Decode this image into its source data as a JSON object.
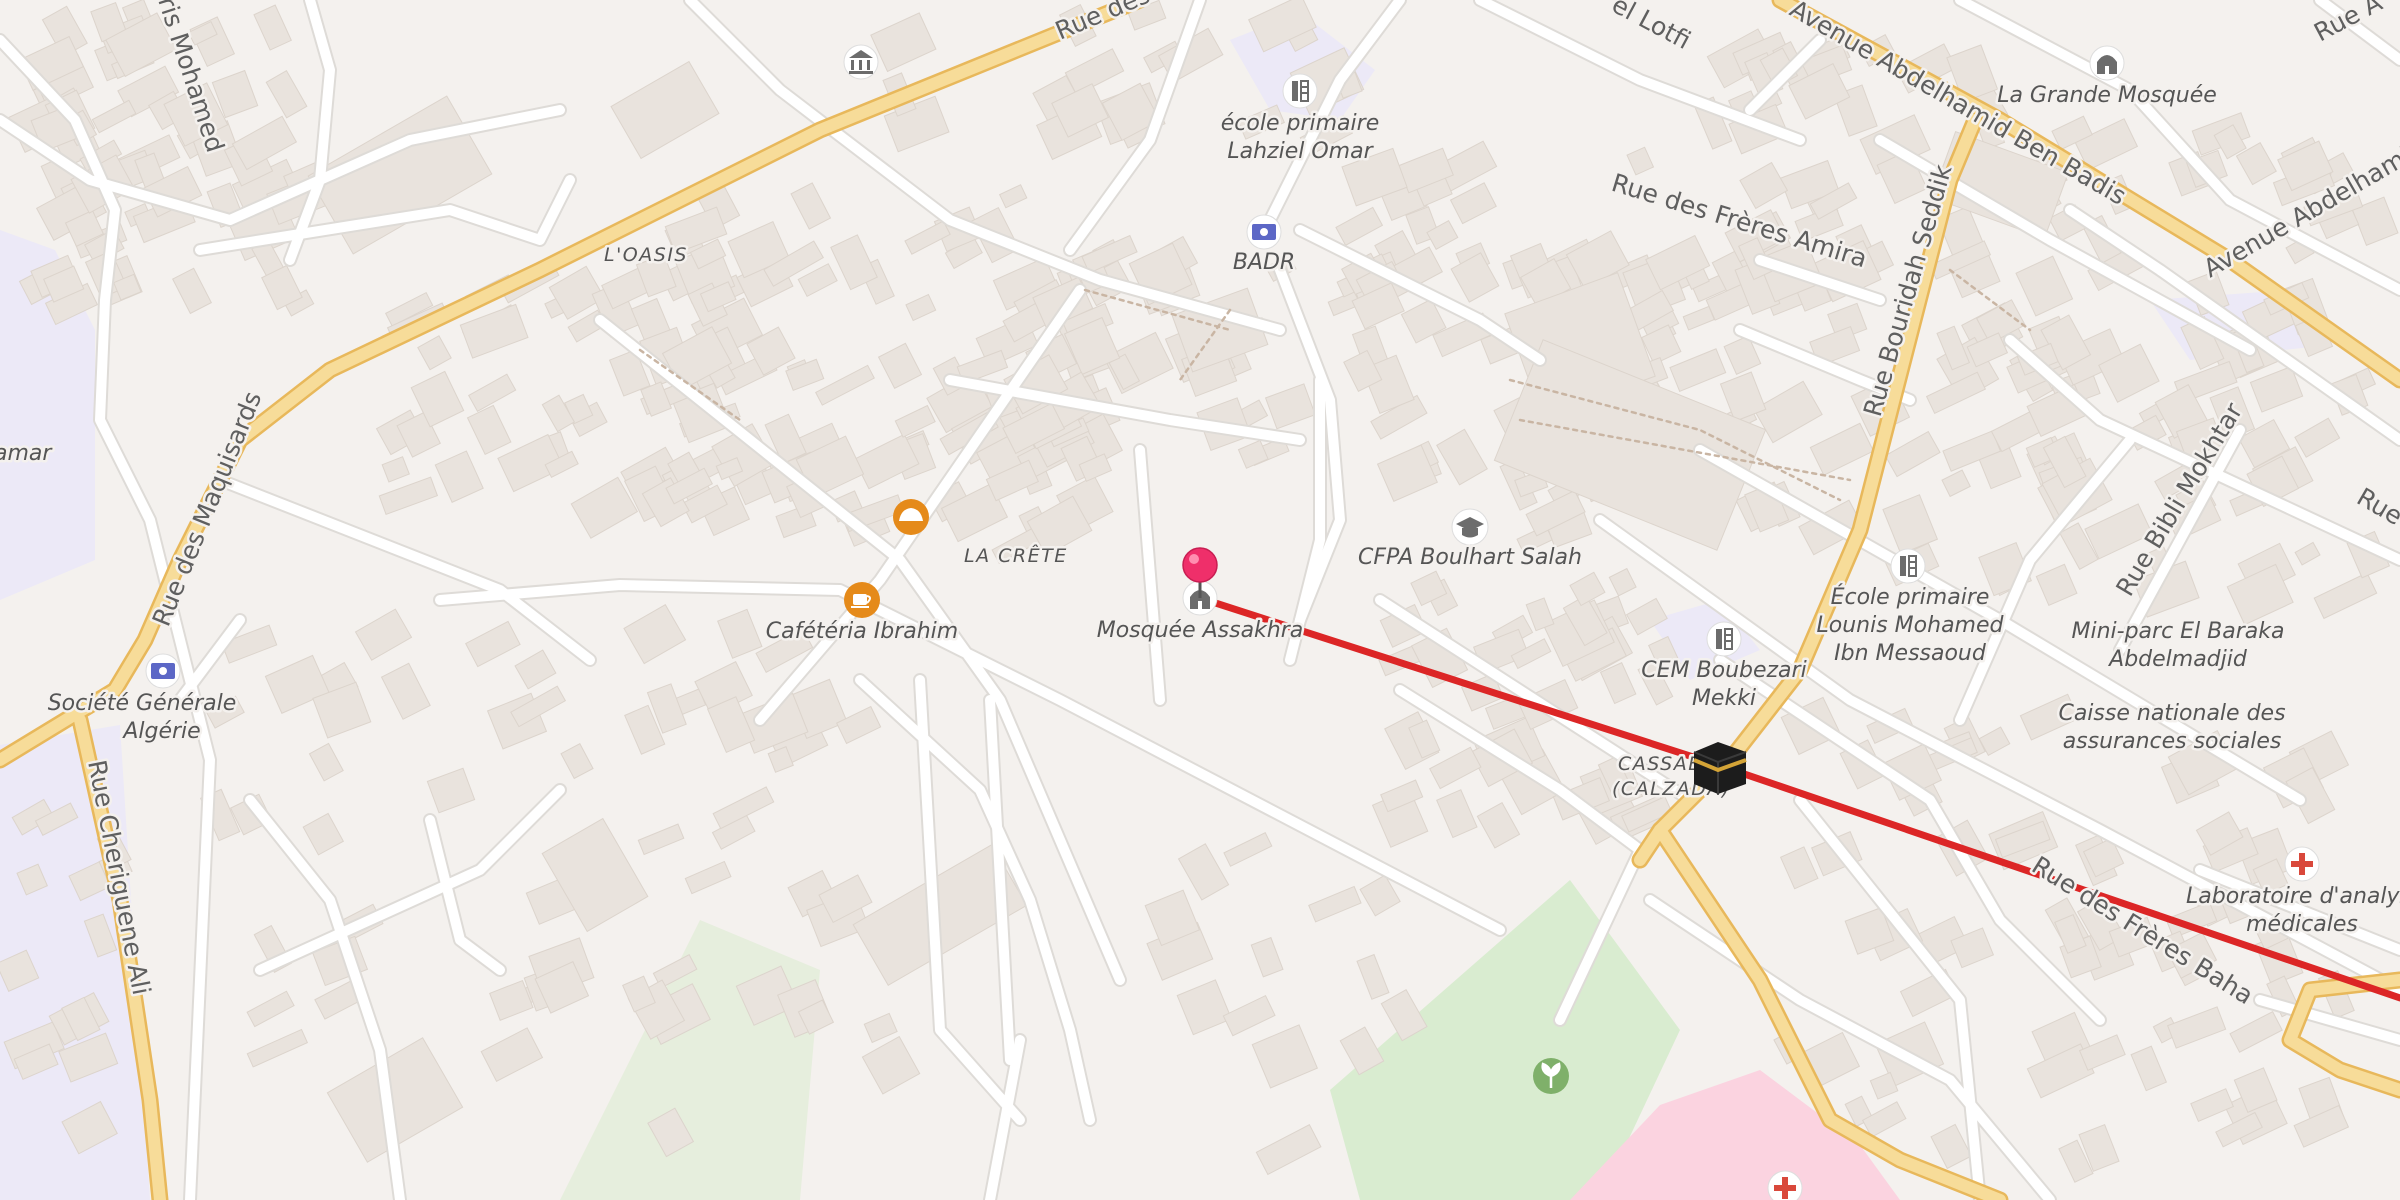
{
  "map": {
    "colors": {
      "background": "#f4f1ee",
      "major_road_fill": "#f7dc99",
      "major_road_casing": "#e8b85b",
      "minor_road": "#ffffff",
      "minor_road_casing": "#dedbd7",
      "building": "#e9e3dd",
      "park": "#d9ecd0",
      "school_area": "#ece9f7",
      "hospital_area": "#fbd3e0",
      "route_line": "#dc2626",
      "pin": "#ef2f6a"
    },
    "street_labels": [
      {
        "text": "Rue des Maquisards"
      },
      {
        "text": "Rue des"
      },
      {
        "text": "Rue Cheriguene Ali"
      },
      {
        "text": "Avenue Abdelhamid Ben Badis"
      },
      {
        "text": "Avenue Abdelhamid"
      },
      {
        "text": "Rue des Frères Amira"
      },
      {
        "text": "Rue Bouridah Seddik"
      },
      {
        "text": "Rue Bibli Mokhtar"
      },
      {
        "text": "Rue des Frères Baha"
      },
      {
        "text": "ris Mohamed"
      },
      {
        "text": "el Lotfi"
      },
      {
        "text": "Rue A"
      },
      {
        "text": "Rue"
      }
    ],
    "area_labels": [
      {
        "text": "L'OASIS"
      },
      {
        "text": "LA CRÊTE"
      },
      {
        "text": "CASSAB"
      },
      {
        "text": "(CALZADA)"
      }
    ],
    "pois": [
      {
        "name": "école primaire Lahziel Omar",
        "lines": [
          "école primaire",
          "Lahziel Omar"
        ],
        "icon": "school-icon"
      },
      {
        "name": "BADR",
        "lines": [
          "BADR"
        ],
        "icon": "bank-icon"
      },
      {
        "name": "La Grande Mosquée",
        "lines": [
          "La Grande Mosquée"
        ],
        "icon": "mosque-icon"
      },
      {
        "name": "CFPA Boulhart Salah",
        "lines": [
          "CFPA Boulhart Salah"
        ],
        "icon": "graduation-cap-icon"
      },
      {
        "name": "École primaire Lounis Mohamed Ibn Messaoud",
        "lines": [
          "École primaire",
          "Lounis Mohamed",
          "Ibn Messaoud"
        ],
        "icon": "school-icon"
      },
      {
        "name": "CEM Boubezari Mekki",
        "lines": [
          "CEM Boubezari",
          "Mekki"
        ],
        "icon": "school-icon"
      },
      {
        "name": "Mini-parc El Baraka Abdelmadjid",
        "lines": [
          "Mini-parc El Baraka",
          "Abdelmadjid"
        ],
        "icon": ""
      },
      {
        "name": "Caisse nationale des assurances sociales",
        "lines": [
          "Caisse nationale des",
          "assurances sociales"
        ],
        "icon": ""
      },
      {
        "name": "Laboratoire d'analyses médicales",
        "lines": [
          "Laboratoire d'analyse",
          "médicales"
        ],
        "icon": "medical-cross-icon"
      },
      {
        "name": "Cafétéria Ibrahim",
        "lines": [
          "Cafétéria Ibrahim"
        ],
        "icon": "coffee-icon"
      },
      {
        "name": "Mosquée Assakhra",
        "lines": [
          "Mosquée Assakhra"
        ],
        "icon": "mosque-icon"
      },
      {
        "name": "Société Générale Algérie",
        "lines": [
          "Société Générale",
          "Algérie"
        ],
        "icon": "bank-icon"
      },
      {
        "name": "amar",
        "lines": [
          "amar"
        ],
        "icon": ""
      }
    ],
    "unlabeled_icons": [
      "museum-icon",
      "bakery-icon",
      "garden-icon",
      "medical-cross-icon"
    ],
    "pin_label": "Mosquée Assakhra",
    "destination_icon": "kaaba-icon"
  }
}
